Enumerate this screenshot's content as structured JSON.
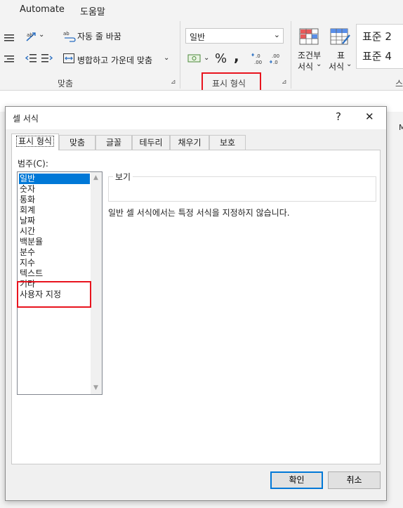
{
  "ribbon": {
    "tabs": [
      "Automate",
      "도움말"
    ],
    "wrap_text": "자동 줄 바꿈",
    "merge_center": "병합하고 가운데 맞춤",
    "alignment_group": "맞춤",
    "number_format_value": "일반",
    "percent_symbol": "%",
    "comma_symbol": ",",
    "number_group": "표시 형식",
    "cond_format_line1": "조건부",
    "cond_format_line2": "서식",
    "table_line1": "표",
    "table_line2": "서식",
    "style1": "표준 2",
    "style2": "표준 4",
    "chevron": "⌄",
    "launcher": "⊿",
    "right_cut_label": "스",
    "strip_glyph": "M"
  },
  "dialog": {
    "title": "셀 서식",
    "help_button": "?",
    "close_button": "✕",
    "tabs": [
      "표시 형식",
      "맞춤",
      "글꼴",
      "테두리",
      "채우기",
      "보호"
    ],
    "category_label": "범주(C):",
    "categories": [
      "일반",
      "숫자",
      "통화",
      "회계",
      "날짜",
      "시간",
      "백분율",
      "분수",
      "지수",
      "텍스트",
      "기타",
      "사용자 지정"
    ],
    "selected_category": "일반",
    "sample_label": "보기",
    "description": "일반 셀 서식에서는 특정 서식을 지정하지 않습니다.",
    "ok_button": "확인",
    "cancel_button": "취소"
  },
  "colors": {
    "accent": "#0078d7",
    "highlight_red": "#e8141e"
  }
}
